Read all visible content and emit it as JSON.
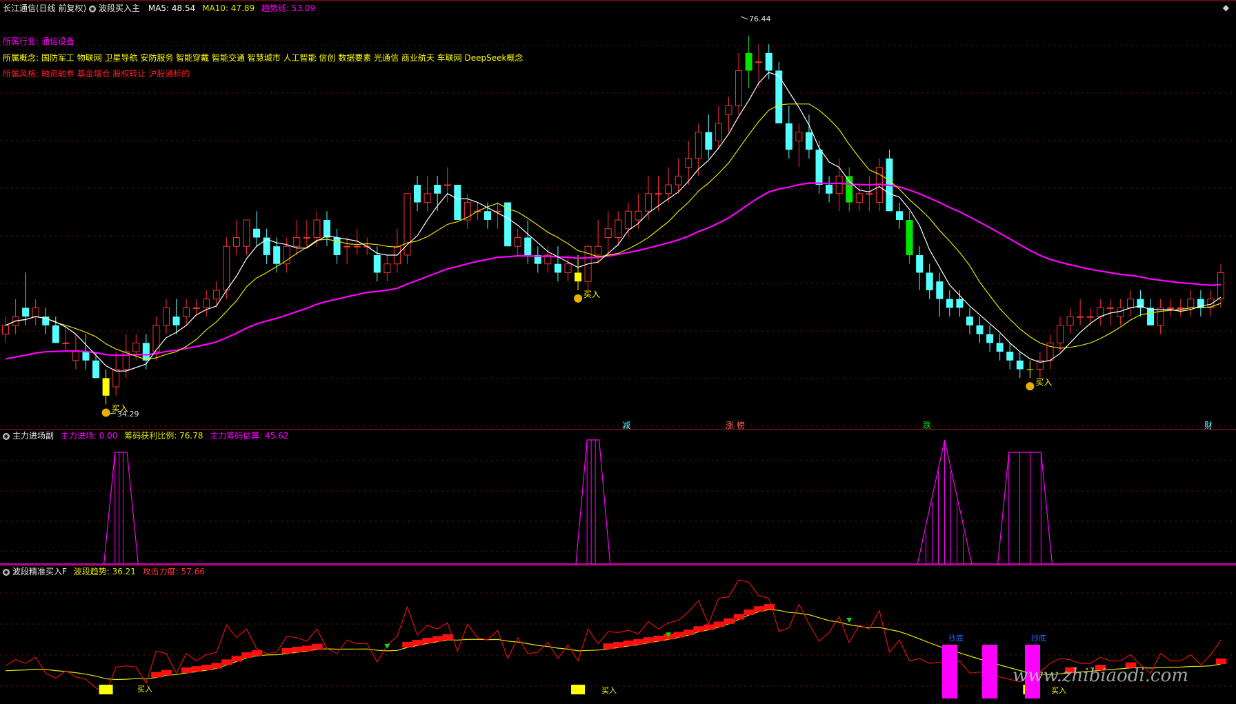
{
  "title": {
    "stock": "长江通信(日线 前复权)",
    "indicator": "波段买入主",
    "ma5_label": "MA5: 48.54",
    "ma10_label": "MA10: 47.89",
    "trend_label": "趋势线: 53.09"
  },
  "info": {
    "industry_label": "所属行业:",
    "industry_value": "通信设备",
    "concept_label": "所属概念:",
    "concept_value": "国防军工 物联网 卫星导航 安防服务 智能穿戴 智能交通 智慧城市 人工智能 信创 数据要素 光通信 商业航天 车联网 DeepSeek概念",
    "style_label": "所属风格:",
    "style_value": "融资融券 基金增仓 股权转让 沪股通标的"
  },
  "main_panel": {
    "high_label": "76.44",
    "low_label": "34.29",
    "buy_label": "买入",
    "events": [
      "减",
      "涨 榜",
      "跌",
      "财"
    ]
  },
  "panel2": {
    "title": "主力进场副",
    "l1": "主力进场: 0.00",
    "l2": "筹码获利比例: 76.78",
    "l3": "主力筹码估算: 45.62"
  },
  "panel3": {
    "title": "波段精准买入F",
    "l1": "波段趋势: 36.21",
    "l2": "攻击力度: 57.66",
    "buy_label": "买入",
    "bottom_label": "抄底"
  },
  "watermark": "www.zhibiaodi.com",
  "colors": {
    "up": "#ff3232",
    "down": "#54ffff",
    "ma_white": "#ffffff",
    "ma_yellow": "#e6e600",
    "trend": "#ff00ff",
    "buy_bar": "#ffff00",
    "big_green": "#00e600",
    "grid": "#8a1515"
  },
  "chart_data": [
    {
      "type": "candlestick",
      "name": "main",
      "price_range": [
        34.29,
        76.44
      ],
      "annotations": {
        "high": 76.44,
        "low": 34.29
      },
      "candles": [
        [
          42,
          44,
          41,
          43
        ],
        [
          43,
          46,
          42,
          44
        ],
        [
          45,
          49,
          43,
          44
        ],
        [
          44,
          46,
          43,
          45
        ],
        [
          44,
          45,
          42,
          43
        ],
        [
          43,
          44,
          41,
          41
        ],
        [
          41,
          43,
          40,
          41
        ],
        [
          39,
          42,
          38,
          40
        ],
        [
          40,
          42,
          38,
          39
        ],
        [
          39,
          40,
          37,
          37
        ],
        [
          37,
          38,
          34,
          35
        ],
        [
          36,
          40,
          35,
          38
        ],
        [
          38,
          42,
          37,
          40
        ],
        [
          40,
          42,
          39,
          41
        ],
        [
          41,
          42,
          38,
          39
        ],
        [
          40,
          44,
          39,
          43
        ],
        [
          43,
          46,
          42,
          45
        ],
        [
          44,
          46,
          42,
          43
        ],
        [
          44,
          46,
          43,
          45
        ],
        [
          45,
          46,
          44,
          45
        ],
        [
          45,
          47,
          44,
          46
        ],
        [
          46,
          48,
          45,
          47
        ],
        [
          47,
          53,
          46,
          52
        ],
        [
          52,
          55,
          51,
          53
        ],
        [
          52,
          55,
          51,
          55
        ],
        [
          54,
          56,
          52,
          53
        ],
        [
          53,
          54,
          50,
          51
        ],
        [
          52,
          53,
          49,
          50
        ],
        [
          50,
          53,
          49,
          52
        ],
        [
          52,
          55,
          51,
          53
        ],
        [
          53,
          55,
          52,
          53
        ],
        [
          53,
          56,
          52,
          55
        ],
        [
          55,
          56,
          52,
          53
        ],
        [
          53,
          54,
          50,
          51
        ],
        [
          52,
          53,
          50,
          52
        ],
        [
          52,
          54,
          51,
          52
        ],
        [
          52,
          53,
          51,
          52
        ],
        [
          51,
          52,
          48,
          49
        ],
        [
          49,
          51,
          48,
          50
        ],
        [
          50,
          54,
          49,
          52
        ],
        [
          51,
          58,
          50,
          58
        ],
        [
          59,
          60,
          56,
          57
        ],
        [
          57,
          60,
          56,
          58
        ],
        [
          59,
          60,
          56,
          58
        ],
        [
          59,
          61,
          57,
          59
        ],
        [
          59,
          59,
          55,
          55
        ],
        [
          55,
          58,
          54,
          57
        ],
        [
          56,
          57,
          55,
          56
        ],
        [
          56,
          57,
          54,
          55
        ],
        [
          56,
          57,
          54,
          56
        ],
        [
          57,
          57,
          52,
          52
        ],
        [
          52,
          54,
          51,
          53
        ],
        [
          53,
          55,
          50,
          51
        ],
        [
          51,
          52,
          49,
          50
        ],
        [
          50,
          52,
          49,
          51
        ],
        [
          50,
          52,
          48,
          49
        ],
        [
          49,
          51,
          48,
          50
        ],
        [
          49,
          51,
          47,
          48
        ],
        [
          48,
          52,
          47,
          52
        ],
        [
          51,
          55,
          50,
          52
        ],
        [
          53,
          56,
          51,
          54
        ],
        [
          53,
          56,
          52,
          55
        ],
        [
          54,
          57,
          53,
          56
        ],
        [
          55,
          58,
          54,
          56
        ],
        [
          56,
          60,
          55,
          58
        ],
        [
          58,
          60,
          56,
          58
        ],
        [
          58,
          61,
          57,
          59
        ],
        [
          59,
          62,
          58,
          60
        ],
        [
          61,
          64,
          59,
          62
        ],
        [
          62,
          66,
          60,
          65
        ],
        [
          65,
          67,
          62,
          63
        ],
        [
          64,
          68,
          63,
          66
        ],
        [
          67,
          69,
          65,
          68
        ],
        [
          68,
          74,
          67,
          72
        ],
        [
          72,
          76,
          70,
          74
        ],
        [
          73,
          75,
          70,
          73
        ],
        [
          74,
          75,
          71,
          72
        ],
        [
          72,
          73,
          66,
          66
        ],
        [
          66,
          68,
          62,
          63
        ],
        [
          64,
          66,
          61,
          65
        ],
        [
          65,
          67,
          62,
          63
        ],
        [
          63,
          64,
          58,
          59
        ],
        [
          59,
          60,
          57,
          58
        ],
        [
          58,
          62,
          56,
          60
        ],
        [
          60,
          61,
          56,
          57
        ],
        [
          57,
          59,
          56,
          58
        ],
        [
          58,
          60,
          56,
          58
        ],
        [
          57,
          62,
          56,
          61
        ],
        [
          62,
          63,
          56,
          56
        ],
        [
          56,
          57,
          54,
          55
        ],
        [
          55,
          56,
          50,
          51
        ],
        [
          51,
          52,
          47,
          49
        ],
        [
          49,
          50,
          46,
          47
        ],
        [
          48,
          49,
          44,
          46
        ],
        [
          46,
          47,
          44,
          45
        ],
        [
          46,
          47,
          44,
          45
        ],
        [
          44,
          45,
          42,
          43
        ],
        [
          43,
          44,
          41,
          42
        ],
        [
          42,
          43,
          40,
          41
        ],
        [
          41,
          42,
          39,
          40
        ],
        [
          40,
          41,
          38,
          39
        ],
        [
          39,
          40,
          37,
          38
        ],
        [
          38,
          39,
          37,
          38
        ],
        [
          38,
          40,
          37,
          39
        ],
        [
          39,
          42,
          38,
          41
        ],
        [
          41,
          44,
          40,
          43
        ],
        [
          43,
          45,
          42,
          44
        ],
        [
          44,
          46,
          43,
          44
        ],
        [
          44,
          45,
          43,
          44
        ],
        [
          44,
          46,
          43,
          45
        ],
        [
          45,
          46,
          43,
          45
        ],
        [
          44,
          46,
          43,
          45
        ],
        [
          45,
          47,
          44,
          46
        ],
        [
          46,
          47,
          44,
          45
        ],
        [
          45,
          46,
          43,
          43
        ],
        [
          43,
          46,
          42,
          45
        ],
        [
          45,
          46,
          44,
          45
        ],
        [
          45,
          46,
          44,
          45
        ],
        [
          45,
          47,
          44,
          46
        ],
        [
          46,
          47,
          44,
          45
        ],
        [
          45,
          47,
          44,
          46
        ],
        [
          46,
          50,
          45,
          49
        ]
      ],
      "buy_signals": [
        10,
        57,
        102
      ],
      "big_green_bars": [
        74,
        84,
        90
      ]
    },
    {
      "type": "line",
      "name": "主力进场副",
      "series": [
        {
          "name": "主力进场",
          "values": [
            0.0
          ]
        },
        {
          "name": "筹码获利比例",
          "values": [
            76.78
          ]
        },
        {
          "name": "主力筹码估算",
          "values": [
            45.62
          ]
        }
      ],
      "spikes": [
        {
          "start": 10,
          "end": 13,
          "peak": 90
        },
        {
          "start": 57,
          "end": 60,
          "peak": 100
        },
        {
          "start": 91,
          "end": 96,
          "peak": 100
        },
        {
          "start": 99,
          "end": 104,
          "peak": 90
        }
      ]
    },
    {
      "type": "line",
      "name": "波段精准买入F",
      "series": [
        {
          "name": "波段趋势",
          "values": [
            36.21
          ]
        },
        {
          "name": "攻击力度",
          "values": [
            57.66
          ]
        }
      ]
    }
  ]
}
